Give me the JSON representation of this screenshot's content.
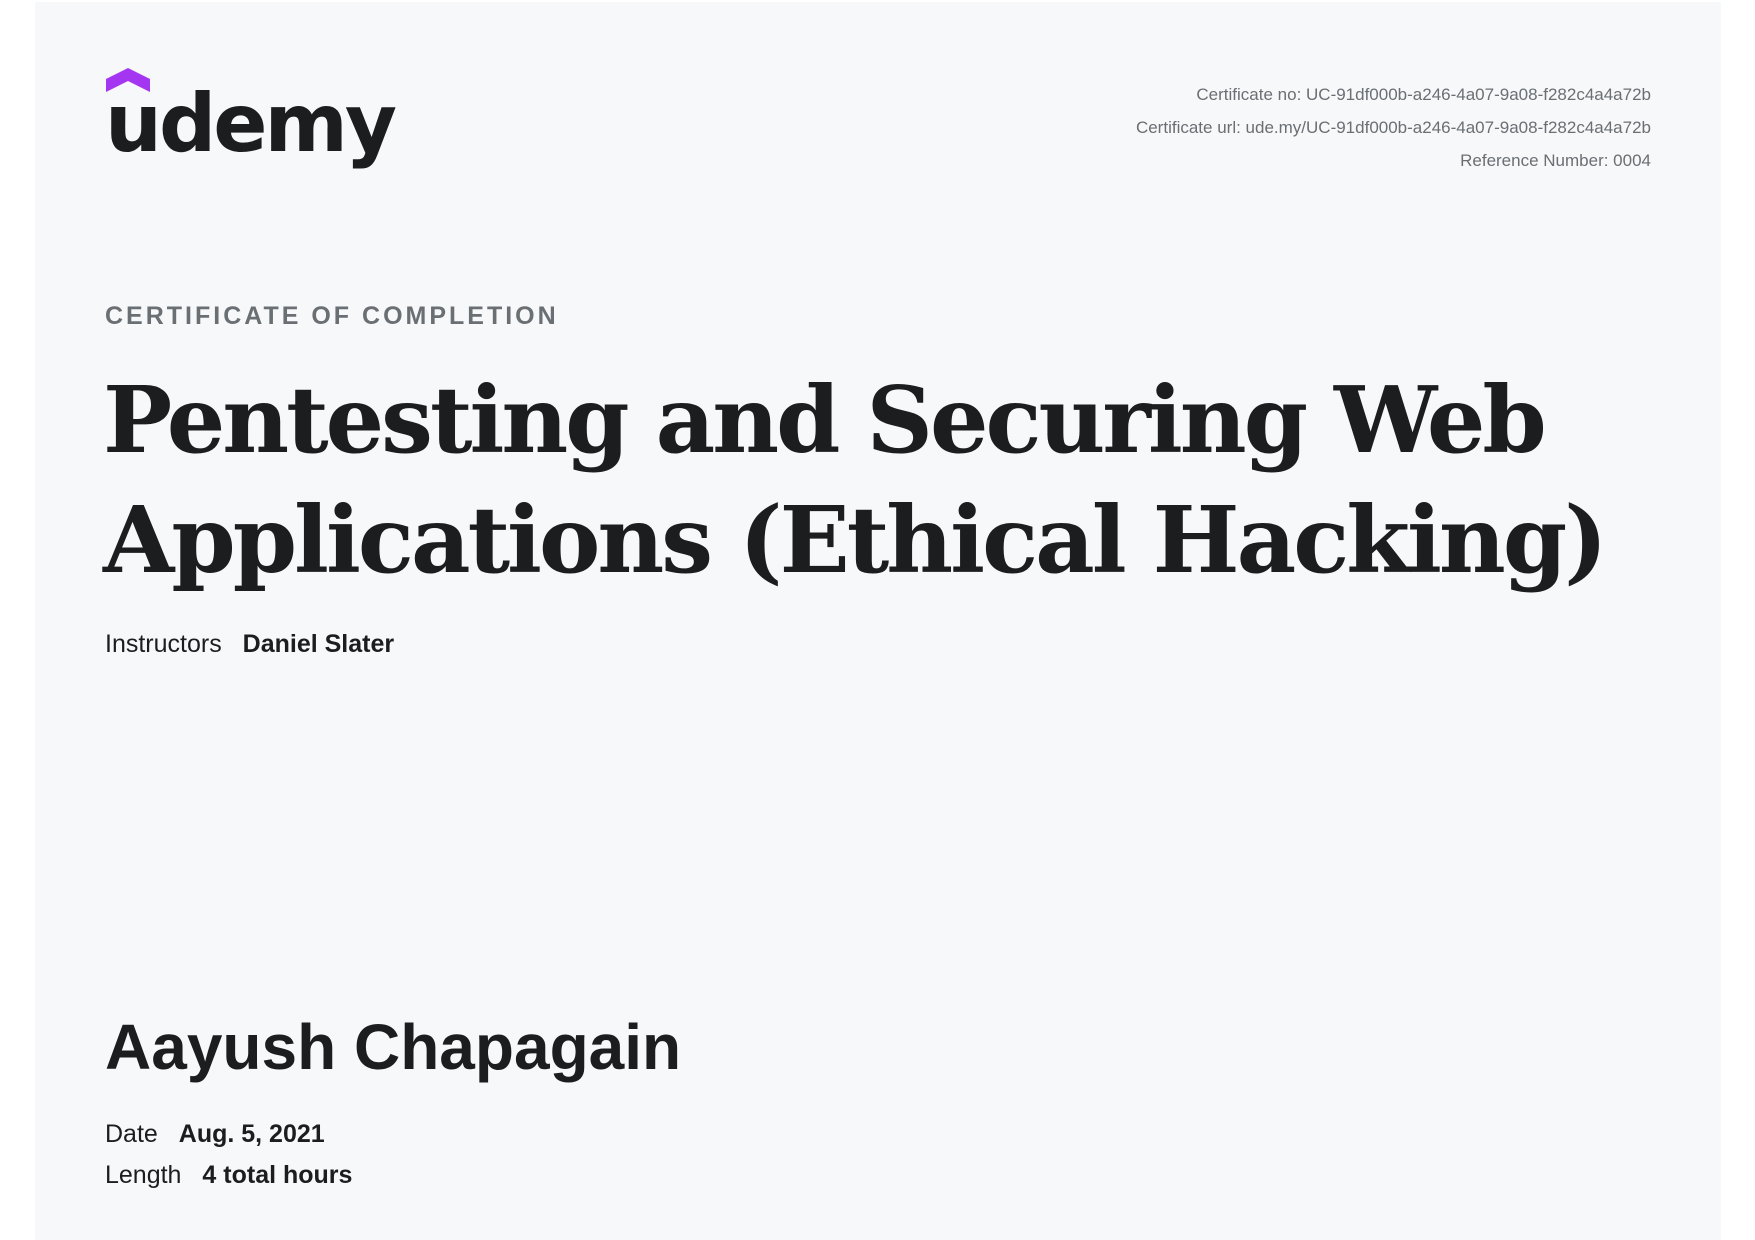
{
  "logo": {
    "wordmark": "udemy",
    "icon": "udemy-logo-icon",
    "accent_color": "#a435f0"
  },
  "meta": {
    "certificate_no": "Certificate no: UC-91df000b-a246-4a07-9a08-f282c4a4a72b",
    "certificate_url": "Certificate url: ude.my/UC-91df000b-a246-4a07-9a08-f282c4a4a72b",
    "reference_number": "Reference Number: 0004"
  },
  "certificate": {
    "heading": "CERTIFICATE OF COMPLETION",
    "course_title": "Pentesting and Securing Web Applications (Ethical Hacking)",
    "instructors_label": "Instructors",
    "instructors_value": "Daniel Slater",
    "recipient": "Aayush Chapagain",
    "date_label": "Date",
    "date_value": "Aug. 5, 2021",
    "length_label": "Length",
    "length_value": "4 total hours"
  },
  "colors": {
    "background": "#f7f8fa",
    "text": "#1c1d1f",
    "muted": "#6a6f73"
  }
}
